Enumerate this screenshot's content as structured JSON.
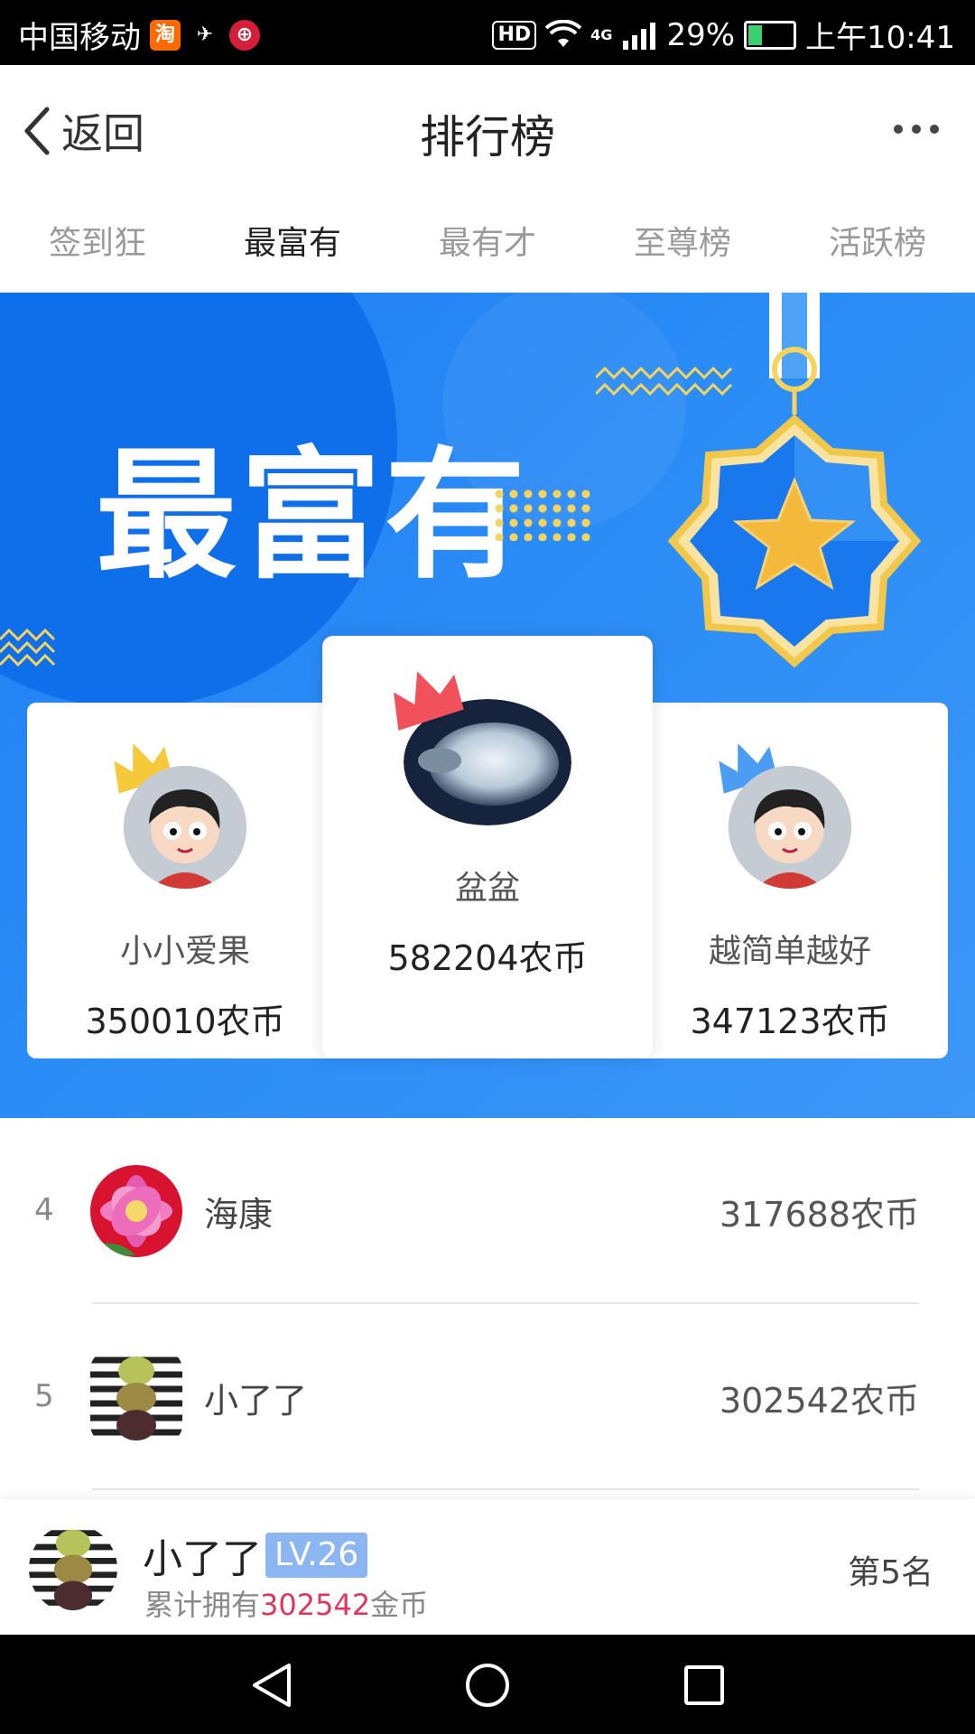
{
  "status_bar": {
    "carrier": "中国移动",
    "hd": "HD",
    "network": "4G",
    "battery": "29%",
    "time": "上午10:41",
    "battery_level": 0.29
  },
  "header": {
    "back_label": "返回",
    "title": "排行榜"
  },
  "tabs": [
    {
      "label": "签到狂"
    },
    {
      "label": "最富有"
    },
    {
      "label": "最有才"
    },
    {
      "label": "至尊榜"
    },
    {
      "label": "活跃榜"
    }
  ],
  "active_tab": "最富有",
  "banner": {
    "title": "最富有"
  },
  "podium": {
    "first": {
      "name": "盆盆",
      "coins": "582204农币"
    },
    "second": {
      "name": "小小爱果",
      "coins": "350010农币"
    },
    "third": {
      "name": "越简单越好",
      "coins": "347123农币"
    }
  },
  "list": [
    {
      "rank": "4",
      "name": "海康",
      "coins": "317688农币"
    },
    {
      "rank": "5",
      "name": "小了了",
      "coins": "302542农币"
    }
  ],
  "me": {
    "name": "小了了",
    "level": "LV.26",
    "desc_prefix": "累计拥有",
    "coins": "302542",
    "desc_suffix": "金币",
    "rank": "第5名"
  },
  "colors": {
    "accent_blue": "#1e7cf2",
    "highlight_red": "#e0365a",
    "level_badge": "#8bb6f2"
  }
}
